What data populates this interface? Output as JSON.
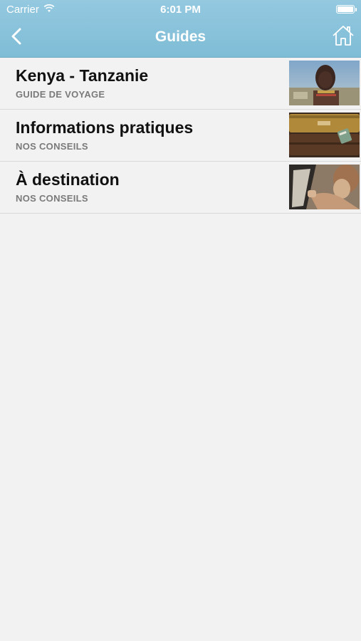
{
  "status_bar": {
    "carrier": "Carrier",
    "time": "6:01 PM"
  },
  "navbar": {
    "title": "Guides",
    "back_icon": "chevron-left-icon",
    "home_icon": "home-icon"
  },
  "colors": {
    "navbar": "#86c1da",
    "background": "#f2f2f2",
    "subtitle": "#7a7a7a"
  },
  "guides": [
    {
      "title": "Kenya - Tanzanie",
      "subtitle": "GUIDE DE VOYAGE",
      "thumb": "portrait-photo"
    },
    {
      "title": "Informations pratiques",
      "subtitle": "NOS CONSEILS",
      "thumb": "suitcases-photo"
    },
    {
      "title": "À destination",
      "subtitle": "NOS CONSEILS",
      "thumb": "car-window-photo"
    }
  ]
}
